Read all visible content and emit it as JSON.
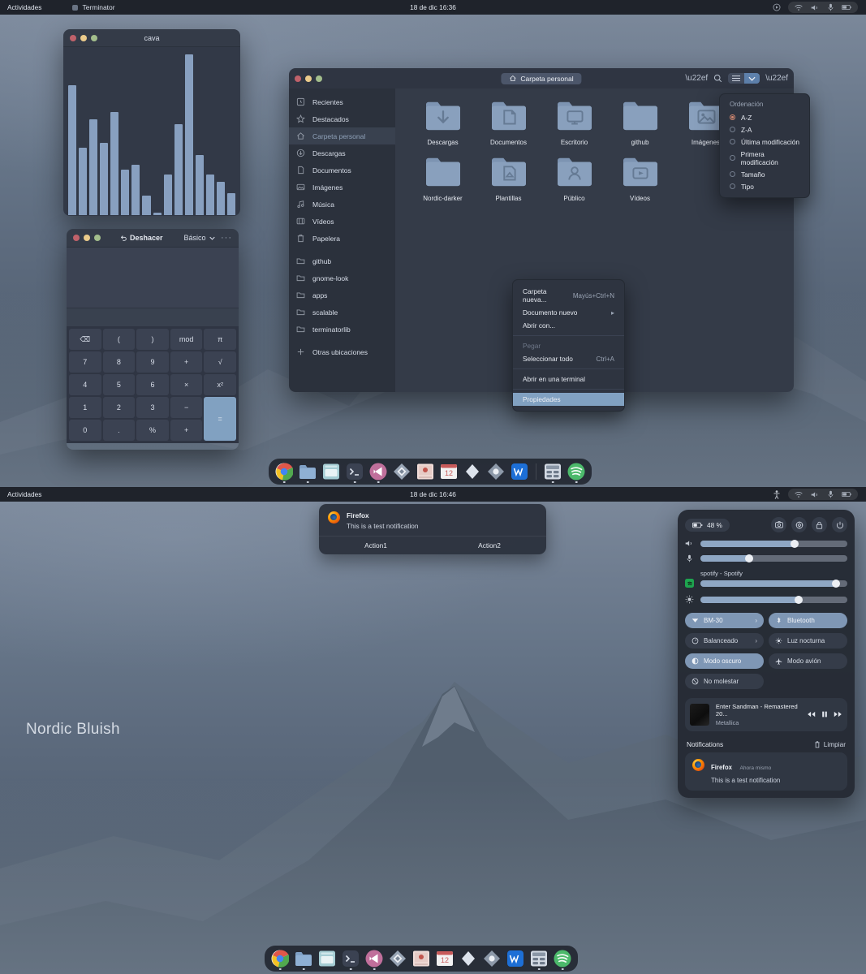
{
  "topbar_upper": {
    "activities": "Actividades",
    "app": "Terminator",
    "clock": "18 de dic  16:36",
    "icons": [
      "record-icon",
      "wifi-icon",
      "volume-icon",
      "mic-icon",
      "battery-icon"
    ]
  },
  "topbar_lower": {
    "activities": "Actividades",
    "app": "",
    "clock": "18 de dic  16:46",
    "icons": [
      "accessibility-icon",
      "wifi-icon",
      "volume-icon",
      "mic-icon",
      "battery-icon"
    ]
  },
  "cava": {
    "title": "cava",
    "bars": [
      54,
      28,
      40,
      30,
      43,
      19,
      21,
      8,
      1,
      17,
      38,
      67,
      25,
      17,
      14,
      9
    ]
  },
  "calculator": {
    "undo_label": "Deshacer",
    "mode_label": "Básico",
    "more_label": "···",
    "display": "",
    "keys": [
      "⌫",
      "(",
      ")",
      "mod",
      "π",
      "7",
      "8",
      "9",
      "+",
      "√",
      "4",
      "5",
      "6",
      "×",
      "x²",
      "1",
      "2",
      "3",
      "−",
      "=",
      "0",
      ".",
      "%",
      "+"
    ],
    "equals_label": "="
  },
  "nautilus": {
    "path": "Carpeta personal",
    "home_icon": "home-icon",
    "toolbar": [
      "more-icon",
      "search-icon",
      "list-view-icon",
      "grid-view-icon",
      "menu-icon"
    ],
    "sidebar": [
      {
        "label": "Recientes",
        "icon": "clock-icon",
        "selected": false
      },
      {
        "label": "Destacados",
        "icon": "star-icon",
        "selected": false
      },
      {
        "label": "Carpeta personal",
        "icon": "home-icon",
        "selected": true
      },
      {
        "label": "Descargas",
        "icon": "download-icon",
        "selected": false
      },
      {
        "label": "Documentos",
        "icon": "document-icon",
        "selected": false
      },
      {
        "label": "Imágenes",
        "icon": "image-icon",
        "selected": false
      },
      {
        "label": "Música",
        "icon": "music-icon",
        "selected": false
      },
      {
        "label": "Vídeos",
        "icon": "video-icon",
        "selected": false
      },
      {
        "label": "Papelera",
        "icon": "trash-icon",
        "selected": false
      }
    ],
    "bookmarks": [
      {
        "label": "github",
        "icon": "folder-icon"
      },
      {
        "label": "gnome-look",
        "icon": "folder-icon"
      },
      {
        "label": "apps",
        "icon": "folder-icon"
      },
      {
        "label": "scalable",
        "icon": "folder-icon"
      },
      {
        "label": "terminatorlib",
        "icon": "folder-icon"
      }
    ],
    "other": {
      "label": "Otras ubicaciones",
      "icon": "plus-icon"
    },
    "files": [
      {
        "name": "Descargas",
        "glyph": "download"
      },
      {
        "name": "Documentos",
        "glyph": "doc"
      },
      {
        "name": "Escritorio",
        "glyph": "monitor"
      },
      {
        "name": "github",
        "glyph": "plain"
      },
      {
        "name": "Imágenes",
        "glyph": "image"
      },
      {
        "name": "Nordic-darker",
        "glyph": "plain"
      },
      {
        "name": "Plantillas",
        "glyph": "template"
      },
      {
        "name": "Público",
        "glyph": "person"
      },
      {
        "name": "Vídeos",
        "glyph": "video"
      }
    ],
    "sort_menu": {
      "title": "Ordenación",
      "options": [
        {
          "label": "A-Z",
          "selected": true
        },
        {
          "label": "Z-A",
          "selected": false
        },
        {
          "label": "Última modificación",
          "selected": false
        },
        {
          "label": "Primera modificación",
          "selected": false
        },
        {
          "label": "Tamaño",
          "selected": false
        },
        {
          "label": "Tipo",
          "selected": false
        }
      ]
    },
    "context_menu": [
      {
        "label": "Carpeta nueva...",
        "accel": "Mayús+Ctrl+N",
        "state": "normal"
      },
      {
        "label": "Documento nuevo",
        "accel": "▸",
        "state": "normal"
      },
      {
        "label": "Abrir con...",
        "accel": "",
        "state": "normal"
      },
      {
        "label": "Pegar",
        "accel": "",
        "state": "disabled"
      },
      {
        "label": "Seleccionar todo",
        "accel": "Ctrl+A",
        "state": "normal"
      },
      {
        "label": "Abrir en una terminal",
        "accel": "",
        "state": "normal"
      },
      {
        "label": "Propiedades",
        "accel": "",
        "state": "selected"
      }
    ]
  },
  "toast": {
    "app": "Firefox",
    "body": "This is a test notification",
    "action1": "Action1",
    "action2": "Action2"
  },
  "control_center": {
    "battery": "48 %",
    "buttons": [
      "screenshot-icon",
      "settings-icon",
      "lock-icon",
      "power-icon"
    ],
    "sliders": [
      {
        "name": "volume",
        "icon": "volume-icon",
        "value": 64
      },
      {
        "name": "microphone",
        "icon": "mic-icon",
        "value": 33
      },
      {
        "name": "media",
        "icon": "spotify-icon",
        "value": 92,
        "label": "spotify - Spotify"
      },
      {
        "name": "brightness",
        "icon": "brightness-icon",
        "value": 67
      }
    ],
    "tiles": [
      {
        "label": "BM-30",
        "icon": "wifi-icon",
        "on": true,
        "chevron": true
      },
      {
        "label": "Bluetooth",
        "icon": "bluetooth-icon",
        "on": true,
        "chevron": false
      },
      {
        "label": "Balanceado",
        "icon": "power-profile-icon",
        "on": false,
        "chevron": true
      },
      {
        "label": "Luz nocturna",
        "icon": "night-light-icon",
        "on": false,
        "chevron": false
      },
      {
        "label": "Modo oscuro",
        "icon": "dark-mode-icon",
        "on": true,
        "chevron": false
      },
      {
        "label": "Modo avión",
        "icon": "airplane-icon",
        "on": false,
        "chevron": false
      },
      {
        "label": "No molestar",
        "icon": "dnd-icon",
        "on": false,
        "chevron": false
      }
    ],
    "media": {
      "title": "Enter Sandman - Remastered 20...",
      "artist": "Metallica",
      "controls": [
        "prev-icon",
        "pause-icon",
        "next-icon"
      ]
    },
    "notifications": {
      "header": "Notifications",
      "clear": "Limpiar",
      "items": [
        {
          "app": "Firefox",
          "when": "Ahora mismo",
          "body": "This is a test notification"
        }
      ]
    }
  },
  "watermark": "Nordic Bluish",
  "dock": {
    "items": [
      {
        "name": "chrome",
        "color": "#e8e8e8",
        "dot": true
      },
      {
        "name": "files",
        "color": "#7ea0c4",
        "dot": true
      },
      {
        "name": "text-editor",
        "color": "#9ec3c9",
        "dot": false
      },
      {
        "name": "terminal",
        "color": "#3b4252",
        "dot": true
      },
      {
        "name": "vscode",
        "color": "#c0679a",
        "dot": true
      },
      {
        "name": "software",
        "color": "#8f9aa8",
        "dot": false
      },
      {
        "name": "image-viewer",
        "color": "#e0b0ad",
        "dot": false
      },
      {
        "name": "calendar",
        "color": "#e2e2e2",
        "dot": false
      },
      {
        "name": "nordic-theme",
        "color": "#d8dee9",
        "dot": false
      },
      {
        "name": "settings",
        "color": "#8f9aa8",
        "dot": false
      },
      {
        "name": "wps-office",
        "color": "#1d6fd6",
        "dot": false
      },
      {
        "name": "calculator",
        "color": "#cfd6e0",
        "dot": true
      },
      {
        "name": "spotify",
        "color": "#4cb96b",
        "dot": true
      }
    ]
  }
}
